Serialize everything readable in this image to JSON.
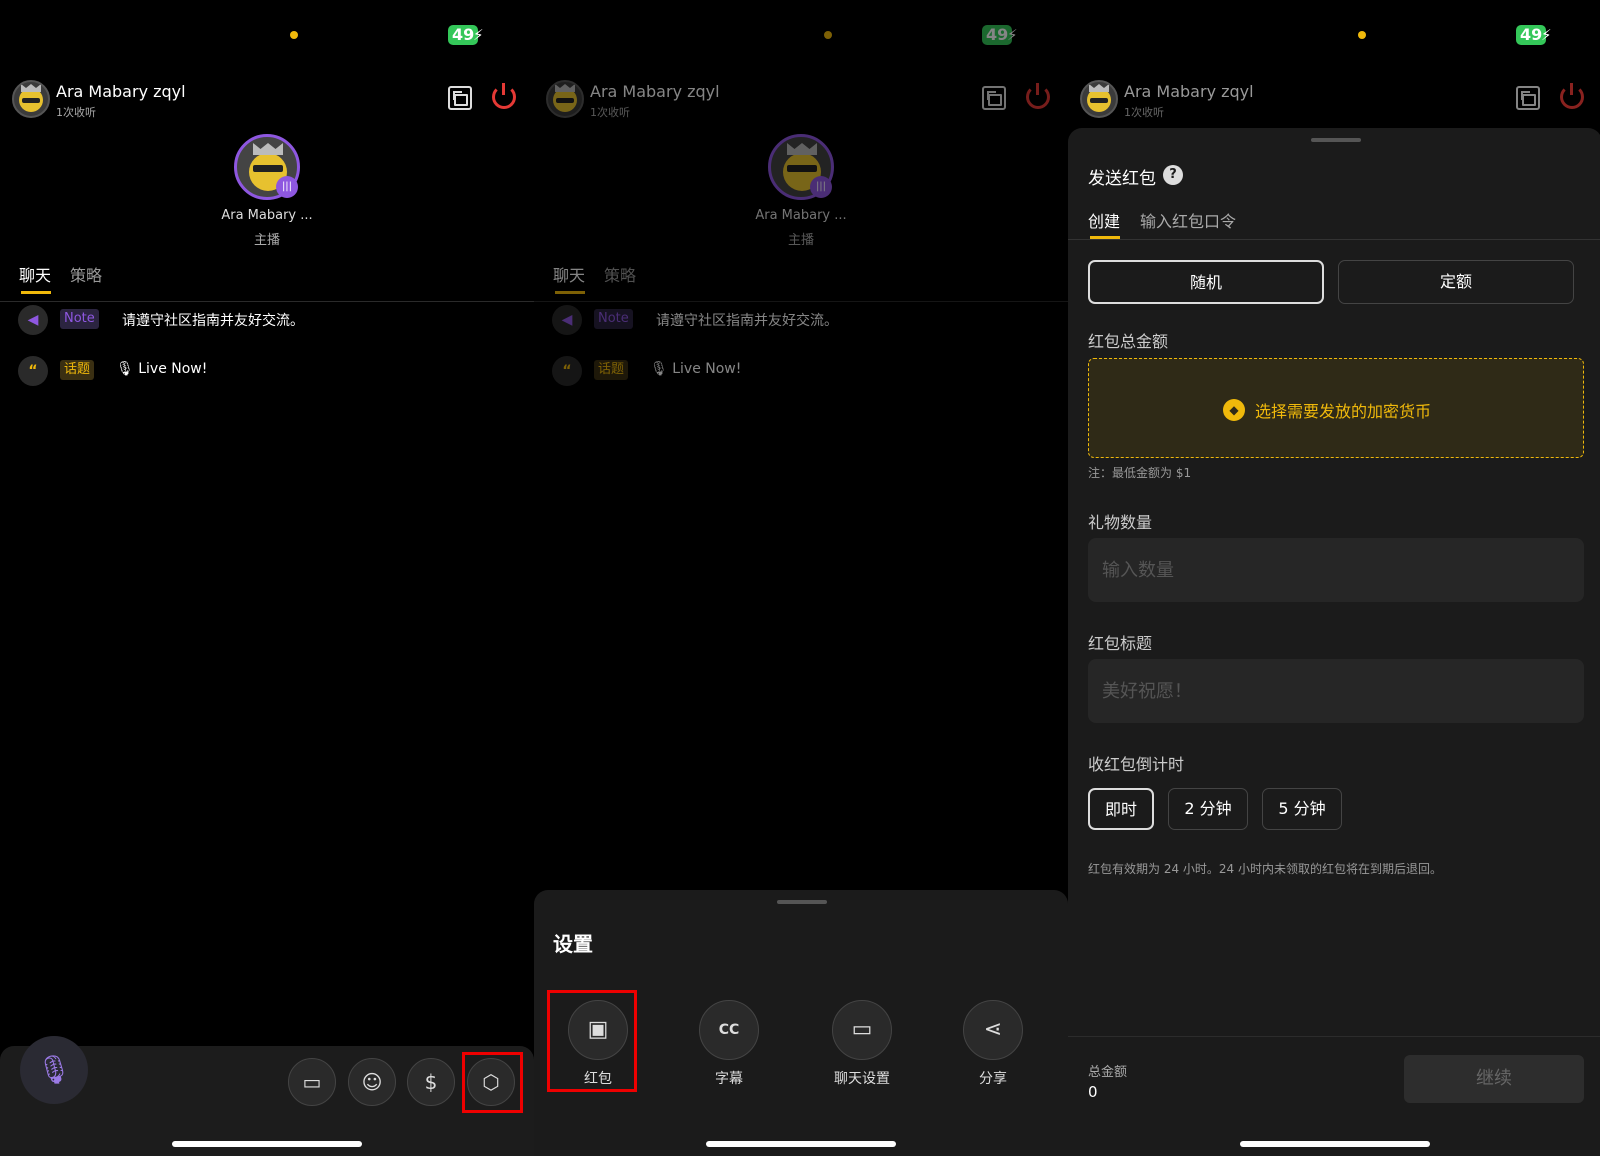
{
  "status": {
    "battery": "49",
    "bolt": "⚡"
  },
  "host": {
    "name": "Ara Mabary zqyl",
    "listens": "1次收听"
  },
  "speaker": {
    "name": "Ara Mabary ...",
    "role": "主播"
  },
  "tabs": {
    "chat": "聊天",
    "strategy": "策略"
  },
  "messages": [
    {
      "tag": "Note",
      "text": "请遵守社区指南并友好交流。"
    },
    {
      "tag": "话题",
      "text": "🎙 Live Now!"
    }
  ],
  "settings": {
    "title": "设置",
    "items": [
      {
        "label": "红包",
        "icon": "red-packet-icon"
      },
      {
        "label": "字幕",
        "icon": "cc-icon"
      },
      {
        "label": "聊天设置",
        "icon": "chat-settings-icon"
      },
      {
        "label": "分享",
        "icon": "share-icon"
      }
    ]
  },
  "red_packet": {
    "title": "发送红包",
    "tab_create": "创建",
    "tab_code": "输入红包口令",
    "mode_random": "随机",
    "mode_fixed": "定额",
    "total_label": "红包总金额",
    "choose_coin": "选择需要发放的加密货币",
    "min_note": "注：最低金额为 $1",
    "gift_count_label": "礼物数量",
    "gift_count_placeholder": "输入数量",
    "title_label": "红包标题",
    "title_placeholder": "美好祝愿！",
    "countdown_label": "收红包倒计时",
    "countdown_options": [
      "即时",
      "2 分钟",
      "5 分钟"
    ],
    "expiry_note": "红包有效期为 24 小时。24 小时内未领取的红包将在到期后退回。",
    "footer_total_label": "总金额",
    "footer_total_value": "0",
    "continue": "继续"
  },
  "colors": {
    "accent": "#f0b90b",
    "purple": "#8e57e0",
    "power": "#e53935",
    "highlight": "#e00000"
  }
}
